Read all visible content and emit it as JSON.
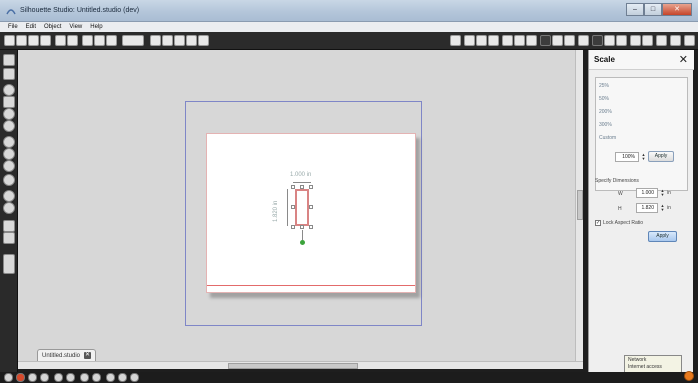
{
  "window": {
    "title": "Silhouette Studio: Untitled.studio (dev)",
    "btn_min": "–",
    "btn_max": "□",
    "btn_close": "✕"
  },
  "menu": [
    "File",
    "Edit",
    "Object",
    "View",
    "Help"
  ],
  "toolbar": {
    "icons": [
      "new-icon",
      "open-icon",
      "save-icon",
      "save-as-icon",
      "print-icon",
      "cut-icon",
      "copy-icon",
      "paste-icon",
      "undo-icon",
      "redo-icon",
      "pointer-icon",
      "zoom-in-icon",
      "zoom-out-icon",
      "pan-icon",
      "fit-icon"
    ],
    "right_icons": [
      "library-icon",
      "store-icon",
      "grid-icon",
      "page-setup-icon",
      "cut-settings-icon",
      "line-style-icon",
      "fill-icon",
      "text-style-icon",
      "replicate-icon",
      "transform-icon",
      "point-edit-icon",
      "offset-icon",
      "trace-icon",
      "send-icon"
    ]
  },
  "left_tools": [
    "select-icon",
    "point-edit-icon",
    "line-icon",
    "rectangle-icon",
    "rounded-rect-icon",
    "ellipse-icon",
    "polygon-icon",
    "curve-icon",
    "freehand-icon",
    "arc-icon",
    "text-icon",
    "eraser-icon",
    "knife-icon",
    "fill-icon",
    "library-panel-icon"
  ],
  "canvas": {
    "width_label": "1.000 in",
    "height_label": "1.820 in"
  },
  "doc_tab": {
    "label": "Untitled.studio",
    "close": "✕"
  },
  "scale_panel": {
    "title": "Scale",
    "close": "✕",
    "presets": [
      "25%",
      "50%",
      "200%",
      "300%",
      "Custom"
    ],
    "custom_value": "100%",
    "apply_label": "Apply",
    "specify_label": "Specify Dimensions",
    "w_label": "W",
    "w_value": "1.000",
    "w_unit": "in",
    "h_label": "H",
    "h_value": "1.820",
    "h_unit": "in",
    "lock_label": "Lock Aspect Ratio",
    "lock_checked": "✓",
    "apply2_label": "Apply"
  },
  "tooltip": {
    "line1": "Network",
    "line2": "Internet access"
  }
}
